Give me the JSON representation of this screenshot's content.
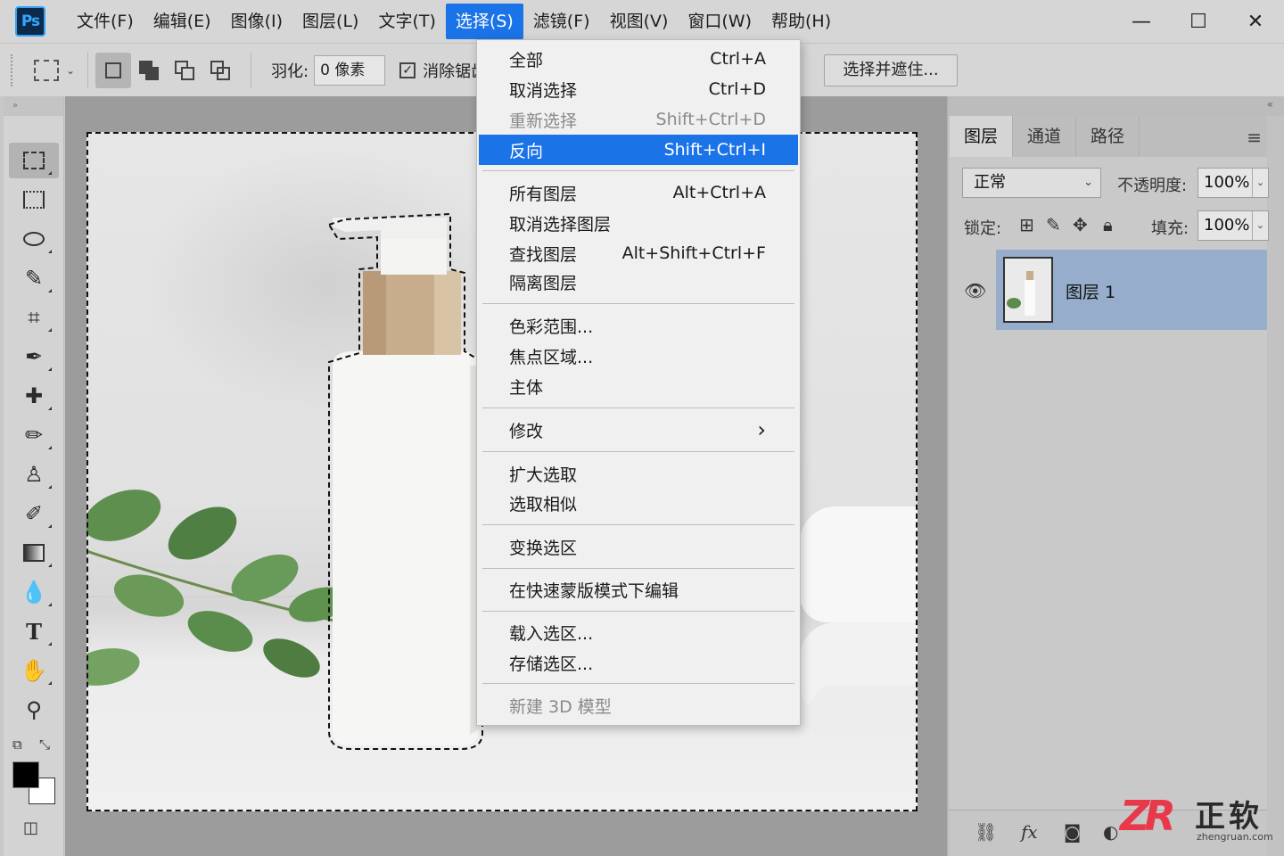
{
  "app": {
    "logo": "Ps"
  },
  "menubar": {
    "items": [
      {
        "label": "文件(F)"
      },
      {
        "label": "编辑(E)"
      },
      {
        "label": "图像(I)"
      },
      {
        "label": "图层(L)"
      },
      {
        "label": "文字(T)"
      },
      {
        "label": "选择(S)"
      },
      {
        "label": "滤镜(F)"
      },
      {
        "label": "视图(V)"
      },
      {
        "label": "窗口(W)"
      },
      {
        "label": "帮助(H)"
      }
    ],
    "active_index": 5
  },
  "window_controls": {
    "minimize": "—",
    "maximize": "☐",
    "close": "✕"
  },
  "options": {
    "feather_label": "羽化:",
    "feather_value": "0 像素",
    "antialias_label": "消除锯齿",
    "antialias_checked": true,
    "select_and_mask": "选择并遮住..."
  },
  "select_menu": {
    "groups": [
      [
        {
          "label": "全部",
          "shortcut": "Ctrl+A"
        },
        {
          "label": "取消选择",
          "shortcut": "Ctrl+D"
        },
        {
          "label": "重新选择",
          "shortcut": "Shift+Ctrl+D",
          "disabled": true
        },
        {
          "label": "反向",
          "shortcut": "Shift+Ctrl+I",
          "highlight": true
        }
      ],
      [
        {
          "label": "所有图层",
          "shortcut": "Alt+Ctrl+A"
        },
        {
          "label": "取消选择图层",
          "shortcut": ""
        },
        {
          "label": "查找图层",
          "shortcut": "Alt+Shift+Ctrl+F"
        },
        {
          "label": "隔离图层",
          "shortcut": ""
        }
      ],
      [
        {
          "label": "色彩范围...",
          "shortcut": ""
        },
        {
          "label": "焦点区域...",
          "shortcut": ""
        },
        {
          "label": "主体",
          "shortcut": ""
        }
      ],
      [
        {
          "label": "修改",
          "shortcut": "›",
          "submenu": true
        }
      ],
      [
        {
          "label": "扩大选取",
          "shortcut": ""
        },
        {
          "label": "选取相似",
          "shortcut": ""
        }
      ],
      [
        {
          "label": "变换选区",
          "shortcut": ""
        }
      ],
      [
        {
          "label": "在快速蒙版模式下编辑",
          "shortcut": ""
        }
      ],
      [
        {
          "label": "载入选区...",
          "shortcut": ""
        },
        {
          "label": "存储选区...",
          "shortcut": ""
        }
      ],
      [
        {
          "label": "新建 3D 模型",
          "shortcut": "",
          "disabled": true
        }
      ]
    ]
  },
  "tools": [
    {
      "name": "rectangular-marquee-icon",
      "glyph": "⬚",
      "active": true
    },
    {
      "name": "artboard-icon",
      "glyph": "▭"
    },
    {
      "name": "lasso-icon",
      "glyph": "ʘ"
    },
    {
      "name": "quick-selection-icon",
      "glyph": "✎"
    },
    {
      "name": "crop-icon",
      "glyph": "⌗"
    },
    {
      "name": "eyedropper-icon",
      "glyph": "⚲"
    },
    {
      "name": "healing-brush-icon",
      "glyph": "✚"
    },
    {
      "name": "brush-icon",
      "glyph": "🖌"
    },
    {
      "name": "clone-stamp-icon",
      "glyph": "♙"
    },
    {
      "name": "history-brush-icon",
      "glyph": "✐"
    },
    {
      "name": "gradient-icon",
      "glyph": "▧"
    },
    {
      "name": "blur-icon",
      "glyph": "💧"
    },
    {
      "name": "type-icon",
      "glyph": "T"
    },
    {
      "name": "hand-icon",
      "glyph": "✋"
    },
    {
      "name": "zoom-icon",
      "glyph": "🔍"
    }
  ],
  "colors": {
    "accent": "#1b73e8",
    "foreground": "#000000",
    "background": "#ffffff",
    "layer_selected": "#96aecb"
  },
  "layers_panel": {
    "tabs": [
      {
        "label": "图层"
      },
      {
        "label": "通道"
      },
      {
        "label": "路径"
      }
    ],
    "active_tab": 0,
    "blend_mode": "正常",
    "opacity_label": "不透明度:",
    "opacity_value": "100%",
    "lock_label": "锁定:",
    "fill_label": "填充:",
    "fill_value": "100%",
    "layers": [
      {
        "name": "图层 1",
        "visible": true,
        "selected": true
      }
    ]
  },
  "watermark": {
    "logo": "ZR",
    "name": "正软",
    "url": "zhengruan.com"
  }
}
